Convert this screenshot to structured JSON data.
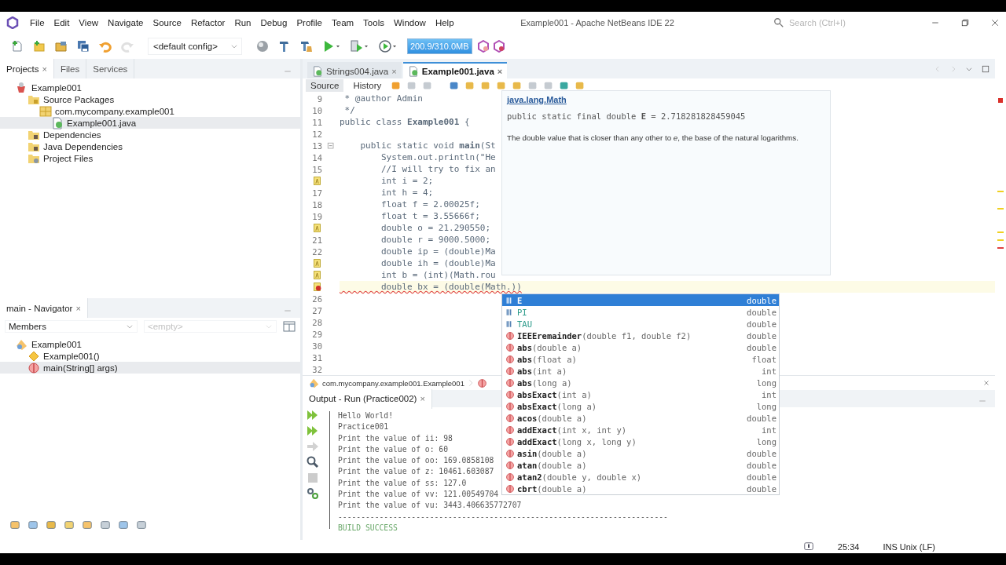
{
  "window": {
    "title": "Example001 - Apache NetBeans IDE 22",
    "search_placeholder": "Search (Ctrl+I)"
  },
  "menu": [
    "File",
    "Edit",
    "View",
    "Navigate",
    "Source",
    "Refactor",
    "Run",
    "Debug",
    "Profile",
    "Team",
    "Tools",
    "Window",
    "Help"
  ],
  "toolbar": {
    "config": "<default config>",
    "memory": "200.9/310.0MB",
    "tools": [
      {
        "kind": "new-file",
        "disabled": false,
        "dropdown": false
      },
      {
        "kind": "new-project",
        "disabled": false,
        "dropdown": false
      },
      {
        "kind": "open-project",
        "disabled": false,
        "dropdown": false
      },
      {
        "kind": "save-all",
        "disabled": false,
        "dropdown": false
      },
      {
        "kind": "undo",
        "disabled": false,
        "dropdown": false
      },
      {
        "kind": "redo",
        "disabled": true,
        "dropdown": false
      }
    ],
    "tools2": [
      {
        "kind": "globe",
        "disabled": false,
        "dropdown": false
      },
      {
        "kind": "build",
        "disabled": false,
        "dropdown": false
      },
      {
        "kind": "clean-build",
        "disabled": false,
        "dropdown": false
      },
      {
        "kind": "run",
        "disabled": false,
        "dropdown": true
      },
      {
        "kind": "debug",
        "disabled": false,
        "dropdown": true
      },
      {
        "kind": "profile",
        "disabled": false,
        "dropdown": true
      }
    ]
  },
  "projects": {
    "tabs": [
      {
        "label": "Projects",
        "selected": true,
        "close": "×"
      },
      {
        "label": "Files",
        "selected": false
      },
      {
        "label": "Services",
        "selected": false
      }
    ],
    "tree": [
      {
        "label": "Example001",
        "kind": "project",
        "selected": false,
        "children": [
          {
            "label": "Source Packages",
            "kind": "source-folder",
            "selected": false,
            "children": [
              {
                "label": "com.mycompany.example001",
                "kind": "package",
                "selected": false,
                "children": [
                  {
                    "label": "Example001.java",
                    "kind": "java-file",
                    "selected": true
                  }
                ]
              }
            ]
          },
          {
            "label": "Dependencies",
            "kind": "library-folder",
            "selected": false
          },
          {
            "label": "Java Dependencies",
            "kind": "library-folder",
            "selected": false
          },
          {
            "label": "Project Files",
            "kind": "files-folder",
            "selected": false
          }
        ]
      }
    ]
  },
  "navigator": {
    "title": "main - Navigator",
    "close": "×",
    "filter": "Members",
    "scope": "<empty>",
    "tree": [
      {
        "label": "Example001",
        "kind": "class",
        "selected": false,
        "children": [
          {
            "label": "Example001()",
            "kind": "constructor",
            "selected": false
          },
          {
            "label": "main(String[] args)",
            "kind": "method",
            "selected": true
          }
        ]
      }
    ]
  },
  "editor": {
    "tabs": [
      {
        "label": "Strings004.java",
        "selected": false,
        "close": "×"
      },
      {
        "label": "Example001.java",
        "selected": true,
        "close": "×"
      }
    ],
    "views": [
      {
        "label": "Source",
        "selected": true
      },
      {
        "label": "History",
        "selected": false
      }
    ],
    "lines": [
      {
        "number": "9",
        "text": " * @author Admin",
        "kind": "plain"
      },
      {
        "number": "10",
        "text": " */",
        "kind": "plain"
      },
      {
        "number": "11",
        "text": "public class **Example001** {",
        "kind": "plain"
      },
      {
        "number": "12",
        "kind": "plain"
      },
      {
        "number": "13",
        "text": "    public static void **main**(St",
        "kind": "fold"
      },
      {
        "number": "14",
        "text": "        System.out.println(\"He",
        "kind": "plain"
      },
      {
        "number": "15",
        "text": "        //I will try to fix an",
        "kind": "plain"
      },
      {
        "text": "        int i = 2;",
        "kind": "warning"
      },
      {
        "number": "17",
        "text": "        int h = 4;",
        "kind": "plain"
      },
      {
        "number": "18",
        "text": "        float f = 2.00025f;",
        "kind": "plain"
      },
      {
        "number": "19",
        "text": "        float t = 3.55666f;",
        "kind": "plain"
      },
      {
        "text": "        double o = 21.290550;",
        "kind": "warning"
      },
      {
        "number": "21",
        "text": "        double r = 9000.5000;",
        "kind": "plain"
      },
      {
        "number": "22",
        "text": "        double ip = (double)Ma",
        "kind": "plain"
      },
      {
        "text": "        double ih = (double)Ma",
        "kind": "warning"
      },
      {
        "text": "        int b = (int)(Math.rou",
        "kind": "warning"
      },
      {
        "text": "        double bx = (double(Math.))",
        "kind": "error"
      },
      {
        "number": "26",
        "kind": "plain"
      },
      {
        "number": "27",
        "kind": "plain"
      },
      {
        "number": "28",
        "kind": "plain"
      },
      {
        "number": "29",
        "kind": "plain"
      },
      {
        "number": "30",
        "kind": "plain"
      },
      {
        "number": "31",
        "kind": "plain"
      },
      {
        "number": "32",
        "kind": "plain"
      }
    ],
    "breadcrumb": "com.mycompany.example001.Example001"
  },
  "javadoc": {
    "link": "java.lang.Math",
    "signature": "public static final double **E** = 2.718281828459045",
    "description": "The double value that is closer than any other to *e*, the base of the natural logarithms."
  },
  "completion": [
    {
      "kind": "field",
      "label": "E",
      "type": "double",
      "selected": true
    },
    {
      "kind": "field",
      "label": "PI",
      "type": "double",
      "selected": false
    },
    {
      "kind": "field",
      "label": "TAU",
      "type": "double",
      "selected": false
    },
    {
      "kind": "method",
      "label": "**IEEEremainder**(double f1, double f2)",
      "type": "double",
      "selected": false
    },
    {
      "kind": "method",
      "label": "**abs**(double a)",
      "type": "double",
      "selected": false
    },
    {
      "kind": "method",
      "label": "**abs**(float a)",
      "type": "float",
      "selected": false
    },
    {
      "kind": "method",
      "label": "**abs**(int a)",
      "type": "int",
      "selected": false
    },
    {
      "kind": "method",
      "label": "**abs**(long a)",
      "type": "long",
      "selected": false
    },
    {
      "kind": "method",
      "label": "**absExact**(int a)",
      "type": "int",
      "selected": false
    },
    {
      "kind": "method",
      "label": "**absExact**(long a)",
      "type": "long",
      "selected": false
    },
    {
      "kind": "method",
      "label": "**acos**(double a)",
      "type": "double",
      "selected": false
    },
    {
      "kind": "method",
      "label": "**addExact**(int x, int y)",
      "type": "int",
      "selected": false
    },
    {
      "kind": "method",
      "label": "**addExact**(long x, long y)",
      "type": "long",
      "selected": false
    },
    {
      "kind": "method",
      "label": "**asin**(double a)",
      "type": "double",
      "selected": false
    },
    {
      "kind": "method",
      "label": "**atan**(double a)",
      "type": "double",
      "selected": false
    },
    {
      "kind": "method",
      "label": "**atan2**(double y, double x)",
      "type": "double",
      "selected": false
    },
    {
      "kind": "method",
      "label": "**cbrt**(double a)",
      "type": "double",
      "selected": false
    }
  ],
  "output": {
    "title": "Output - Run (Practice002)",
    "close": "×",
    "tools": [
      {
        "kind": "rerun",
        "disabled": false
      },
      {
        "kind": "rerun",
        "disabled": false
      },
      {
        "kind": "step",
        "disabled": true
      },
      {
        "kind": "find",
        "disabled": false
      },
      {
        "kind": "stop",
        "disabled": true
      },
      {
        "kind": "settings",
        "disabled": false
      }
    ],
    "lines": [
      {
        "text": "Hello World!",
        "kind": "plain"
      },
      {
        "text": "Practice001",
        "kind": "plain"
      },
      {
        "text": "Print the value of ii: 98",
        "kind": "plain"
      },
      {
        "text": "Print the value of o: 60",
        "kind": "plain"
      },
      {
        "text": "Print the value of oo: 169.0858108",
        "kind": "plain"
      },
      {
        "text": "Print the value of z: 10461.603087",
        "kind": "plain"
      },
      {
        "text": "Print the value of ss: 127.0",
        "kind": "plain"
      },
      {
        "text": "Print the value of vv: 121.00549704",
        "kind": "plain"
      },
      {
        "text": "Print the value of vu: 3443.406635772707",
        "kind": "plain"
      },
      {
        "text": "------------------------------------------------------------------------",
        "kind": "plain"
      },
      {
        "text": "BUILD SUCCESS",
        "kind": "success"
      }
    ]
  },
  "status": {
    "position": "25:34",
    "mode": "INS Unix (LF)"
  }
}
